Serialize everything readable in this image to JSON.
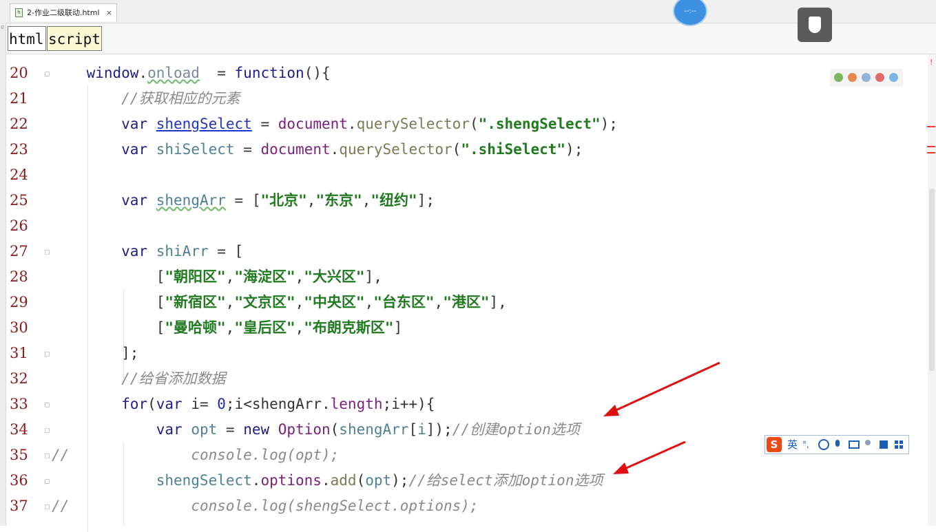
{
  "tab": {
    "title": "2-作业二级联动.html",
    "close": "×"
  },
  "left_strip_char": "e",
  "breadcrumb": [
    "html",
    "script"
  ],
  "timer_text": "--:--",
  "ime_bar": {
    "logo": "S",
    "mode": "英",
    "punct": "°,"
  },
  "error_marker": "!",
  "code_lines": [
    {
      "n": "20",
      "tokens": [
        [
          "",
          "    "
        ],
        [
          "kw",
          "window"
        ],
        [
          "",
          "."
        ],
        [
          "prop wavy",
          "onload"
        ],
        [
          "",
          "  = "
        ],
        [
          "kw",
          "function"
        ],
        [
          "",
          "(){"
        ]
      ]
    },
    {
      "n": "21",
      "tokens": [
        [
          "",
          "        "
        ],
        [
          "cm",
          "//获取相应的元素"
        ]
      ]
    },
    {
      "n": "22",
      "tokens": [
        [
          "",
          "        "
        ],
        [
          "kw",
          "var"
        ],
        [
          "",
          " "
        ],
        [
          "ulink",
          "shengSelect"
        ],
        [
          "",
          " = "
        ],
        [
          "fn",
          "document"
        ],
        [
          "",
          "."
        ],
        [
          "meth",
          "querySelector"
        ],
        [
          "",
          "("
        ],
        [
          "str",
          "\".shengSelect\""
        ],
        [
          "",
          ");"
        ]
      ]
    },
    {
      "n": "23",
      "tokens": [
        [
          "",
          "        "
        ],
        [
          "kw",
          "var"
        ],
        [
          "",
          " "
        ],
        [
          "var",
          "shiSelect"
        ],
        [
          "",
          " = "
        ],
        [
          "fn",
          "document"
        ],
        [
          "",
          "."
        ],
        [
          "meth",
          "querySelector"
        ],
        [
          "",
          "("
        ],
        [
          "str",
          "\".shiSelect\""
        ],
        [
          "",
          ");"
        ]
      ]
    },
    {
      "n": "24",
      "tokens": []
    },
    {
      "n": "25",
      "tokens": [
        [
          "",
          "        "
        ],
        [
          "kw",
          "var"
        ],
        [
          "",
          " "
        ],
        [
          "var wavy",
          "shengArr"
        ],
        [
          "",
          " = ["
        ],
        [
          "str",
          "\"北京\""
        ],
        [
          "",
          ","
        ],
        [
          "str",
          "\"东京\""
        ],
        [
          "",
          ","
        ],
        [
          "str",
          "\"纽约\""
        ],
        [
          "",
          "];"
        ]
      ]
    },
    {
      "n": "26",
      "tokens": []
    },
    {
      "n": "27",
      "tokens": [
        [
          "",
          "        "
        ],
        [
          "kw",
          "var"
        ],
        [
          "",
          " "
        ],
        [
          "var",
          "shiArr"
        ],
        [
          "",
          " = ["
        ]
      ]
    },
    {
      "n": "28",
      "tokens": [
        [
          "",
          "            ["
        ],
        [
          "str",
          "\"朝阳区\""
        ],
        [
          "",
          ","
        ],
        [
          "str",
          "\"海淀区\""
        ],
        [
          "",
          ","
        ],
        [
          "str",
          "\"大兴区\""
        ],
        [
          "",
          "],"
        ]
      ]
    },
    {
      "n": "29",
      "tokens": [
        [
          "",
          "            ["
        ],
        [
          "str",
          "\"新宿区\""
        ],
        [
          "",
          ","
        ],
        [
          "str",
          "\"文京区\""
        ],
        [
          "",
          ","
        ],
        [
          "str",
          "\"中央区\""
        ],
        [
          "",
          ","
        ],
        [
          "str",
          "\"台东区\""
        ],
        [
          "",
          ","
        ],
        [
          "str",
          "\"港区\""
        ],
        [
          "",
          "],"
        ]
      ]
    },
    {
      "n": "30",
      "tokens": [
        [
          "",
          "            ["
        ],
        [
          "str",
          "\"曼哈顿\""
        ],
        [
          "",
          ","
        ],
        [
          "str",
          "\"皇后区\""
        ],
        [
          "",
          ","
        ],
        [
          "str",
          "\"布朗克斯区\""
        ],
        [
          "",
          "]"
        ]
      ]
    },
    {
      "n": "31",
      "tokens": [
        [
          "",
          "        ];"
        ]
      ]
    },
    {
      "n": "32",
      "tokens": [
        [
          "",
          "        "
        ],
        [
          "cm",
          "//给省添加数据"
        ]
      ]
    },
    {
      "n": "33",
      "tokens": [
        [
          "",
          "        "
        ],
        [
          "kw",
          "for"
        ],
        [
          "",
          "("
        ],
        [
          "kw",
          "var"
        ],
        [
          "",
          " i= "
        ],
        [
          "num",
          "0"
        ],
        [
          "",
          ";i<shengArr."
        ],
        [
          "fn",
          "length"
        ],
        [
          "",
          ";i++){"
        ]
      ]
    },
    {
      "n": "34",
      "tokens": [
        [
          "",
          "            "
        ],
        [
          "kw",
          "var"
        ],
        [
          "",
          " "
        ],
        [
          "var",
          "opt"
        ],
        [
          "",
          " = "
        ],
        [
          "kw",
          "new"
        ],
        [
          "",
          " "
        ],
        [
          "fn",
          "Option"
        ],
        [
          "",
          "("
        ],
        [
          "var",
          "shengArr"
        ],
        [
          "",
          "["
        ],
        [
          "var",
          "i"
        ],
        [
          "",
          "]);"
        ],
        [
          "cm",
          "//创建option选项"
        ]
      ]
    },
    {
      "n": "35",
      "tokens": [
        [
          "cm",
          "//"
        ],
        [
          "",
          "              "
        ],
        [
          "cm",
          "console.log(opt);"
        ]
      ]
    },
    {
      "n": "36",
      "tokens": [
        [
          "",
          "            "
        ],
        [
          "var",
          "shengSelect"
        ],
        [
          "",
          "."
        ],
        [
          "fn",
          "options"
        ],
        [
          "",
          "."
        ],
        [
          "meth",
          "add"
        ],
        [
          "",
          "("
        ],
        [
          "var",
          "opt"
        ],
        [
          "",
          ");"
        ],
        [
          "cm",
          "//给select添加option选项"
        ]
      ]
    },
    {
      "n": "37",
      "tokens": [
        [
          "cm",
          "//"
        ],
        [
          "",
          "              "
        ],
        [
          "cm",
          "console.log(shengSelect.options);"
        ]
      ]
    }
  ],
  "colors": {
    "line_number": "#8b1a1a",
    "keyword": "#1e1e8a",
    "string": "#207a20",
    "comment": "#8a8a8a",
    "arrow": "#e01010"
  }
}
